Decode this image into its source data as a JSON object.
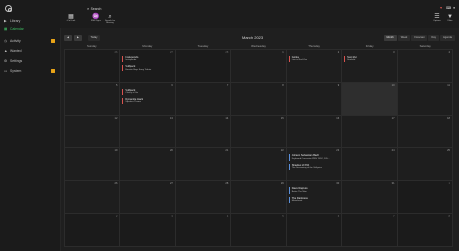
{
  "app": {
    "title": "Lidarr"
  },
  "colors": {
    "accent": "#3fbf63",
    "event_red": "#d9534f",
    "event_blue": "#5b8fd9",
    "badge": "#e8a317"
  },
  "search": {
    "placeholder": "Search"
  },
  "sidebar": {
    "items": [
      {
        "label": "Library",
        "icon": "play-icon"
      },
      {
        "label": "Calendar",
        "icon": "calendar-icon"
      },
      {
        "label": "Activity",
        "icon": "clock-icon"
      },
      {
        "label": "Wanted",
        "icon": "warning-icon"
      },
      {
        "label": "Settings",
        "icon": "wrench-icon"
      },
      {
        "label": "System",
        "icon": "monitor-icon"
      }
    ]
  },
  "toolbar": {
    "ical_label": "iCal Link",
    "rss_label": "RSS Sync",
    "search_missing_label": "Search for Missing",
    "options_label": "Options",
    "filter_label": "Filter"
  },
  "nav": {
    "prev": "◀",
    "next": "▶",
    "today": "Today",
    "month_title": "March 2023",
    "views": [
      "Month",
      "Week",
      "Forecast",
      "Day",
      "Agenda"
    ],
    "selected_view": "Month"
  },
  "weekdays": [
    "Sunday",
    "Monday",
    "Tuesday",
    "Wednesday",
    "Thursday",
    "Friday",
    "Saturday"
  ],
  "weeks": [
    [
      {
        "day": "26",
        "other": true,
        "events": []
      },
      {
        "day": "27",
        "other": true,
        "events": [
          {
            "title": "Instupendo",
            "subtitle": "Instupendo",
            "color": "red"
          },
          {
            "title": "Vulfpeck",
            "subtitle": "Beastie Boys Song Tribute",
            "color": "red"
          }
        ]
      },
      {
        "day": "28",
        "other": true,
        "events": []
      },
      {
        "day": "1",
        "events": []
      },
      {
        "day": "2",
        "events": [
          {
            "title": "Gorka",
            "subtitle": "Live in Red Zoo",
            "color": "red"
          }
        ]
      },
      {
        "day": "3",
        "events": [
          {
            "title": "Suni Zur",
            "subtitle": "Starfield",
            "color": "red"
          }
        ]
      },
      {
        "day": "4",
        "events": []
      }
    ],
    [
      {
        "day": "5",
        "events": []
      },
      {
        "day": "6",
        "events": [
          {
            "title": "Vulfpeck",
            "subtitle": "Cherry of Go",
            "color": "red"
          },
          {
            "title": "Dynamite Hack",
            "subtitle": "Speaker Theme",
            "color": "red"
          }
        ]
      },
      {
        "day": "7",
        "events": []
      },
      {
        "day": "8",
        "events": []
      },
      {
        "day": "9",
        "events": []
      },
      {
        "day": "10",
        "today": true,
        "events": []
      },
      {
        "day": "11",
        "events": []
      }
    ],
    [
      {
        "day": "12",
        "events": []
      },
      {
        "day": "13",
        "events": []
      },
      {
        "day": "14",
        "events": []
      },
      {
        "day": "15",
        "events": []
      },
      {
        "day": "16",
        "events": []
      },
      {
        "day": "17",
        "events": []
      },
      {
        "day": "18",
        "events": []
      }
    ],
    [
      {
        "day": "19",
        "events": []
      },
      {
        "day": "20",
        "events": []
      },
      {
        "day": "21",
        "events": []
      },
      {
        "day": "22",
        "events": []
      },
      {
        "day": "23",
        "events": [
          {
            "title": "Johann Sebastian Bach",
            "subtitle": "Keyboard Concertos BWV 1052, 105...",
            "color": "blue"
          },
          {
            "title": "Shadow of Pith",
            "subtitle": "The Screaming of the Valkyries",
            "color": "blue"
          }
        ]
      },
      {
        "day": "24",
        "events": []
      },
      {
        "day": "25",
        "events": []
      }
    ],
    [
      {
        "day": "26",
        "events": []
      },
      {
        "day": "27",
        "events": []
      },
      {
        "day": "28",
        "events": []
      },
      {
        "day": "29",
        "events": []
      },
      {
        "day": "30",
        "events": [
          {
            "title": "Dave Rapture",
            "subtitle": "Better The Man",
            "color": "blue"
          },
          {
            "title": "The Darkness",
            "subtitle": "Motorheart",
            "color": "blue"
          }
        ]
      },
      {
        "day": "31",
        "events": []
      },
      {
        "day": "1",
        "other": true,
        "events": []
      }
    ],
    [
      {
        "day": "2",
        "other": true,
        "events": []
      },
      {
        "day": "3",
        "other": true,
        "events": []
      },
      {
        "day": "4",
        "other": true,
        "events": []
      },
      {
        "day": "5",
        "other": true,
        "events": []
      },
      {
        "day": "6",
        "other": true,
        "events": []
      },
      {
        "day": "7",
        "other": true,
        "events": []
      },
      {
        "day": "8",
        "other": true,
        "events": []
      }
    ]
  ]
}
